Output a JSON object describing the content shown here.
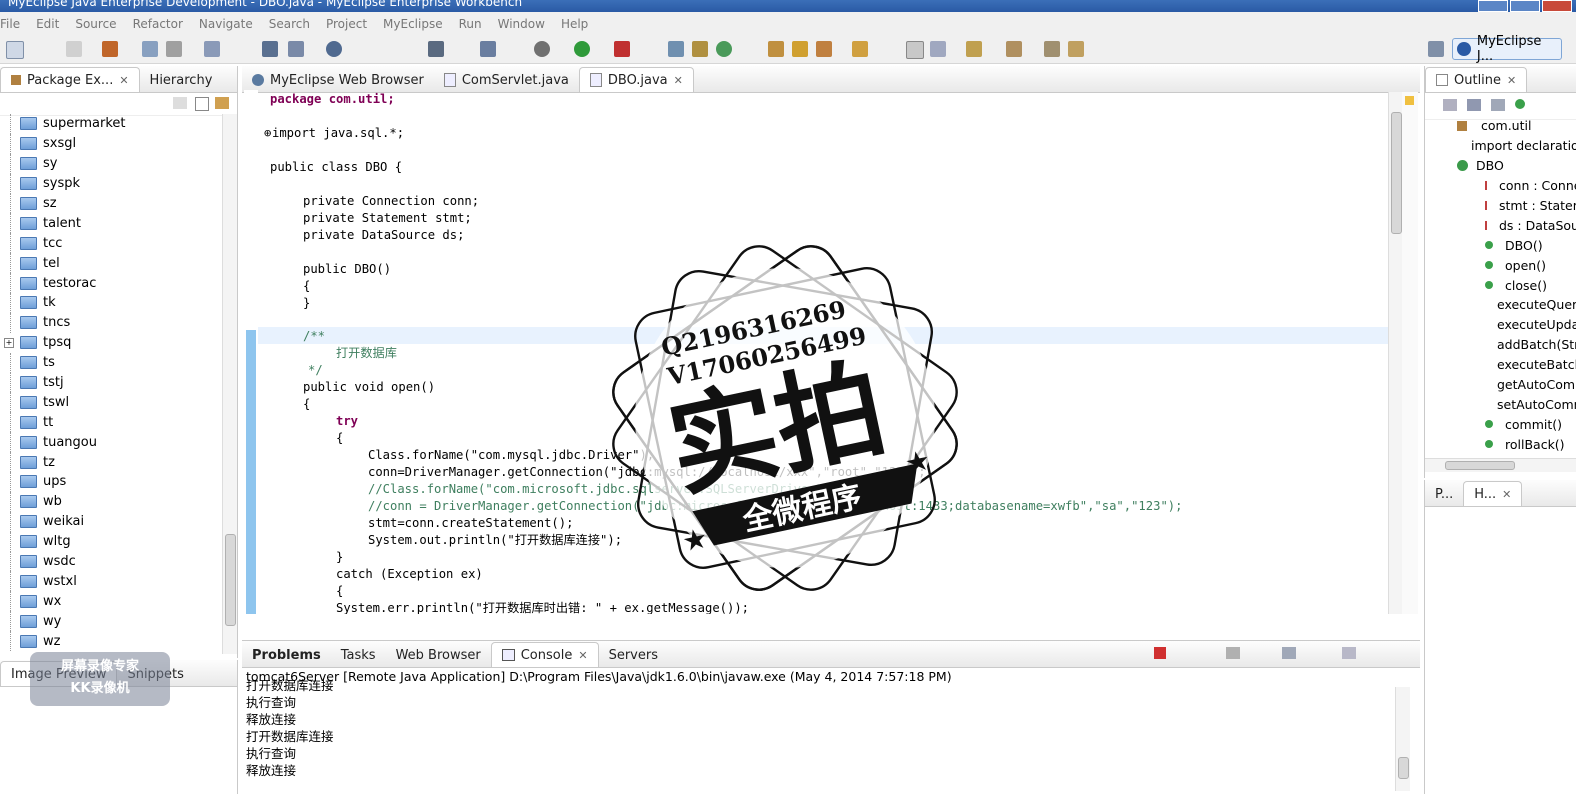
{
  "window": {
    "title": "MyEclipse Java Enterprise Development - DBO.java - MyEclipse Enterprise Workbench"
  },
  "menu": [
    "File",
    "Edit",
    "Source",
    "Refactor",
    "Navigate",
    "Search",
    "Project",
    "MyEclipse",
    "Run",
    "Window",
    "Help"
  ],
  "perspective": {
    "label": "MyEclipse J..."
  },
  "package_explorer": {
    "tabs": [
      "Package Ex...",
      "Hierarchy"
    ],
    "items": [
      "supermarket",
      "sxsgl",
      "sy",
      "syspk",
      "sz",
      "talent",
      "tcc",
      "tel",
      "testorac",
      "tk",
      "tncs",
      "tpsq",
      "ts",
      "tstj",
      "tswl",
      "tt",
      "tuangou",
      "tz",
      "ups",
      "wb",
      "weikai",
      "wltg",
      "wsdc",
      "wstxl",
      "wx",
      "wy",
      "wz"
    ]
  },
  "image_preview": {
    "tabs": [
      "Image Preview",
      "Snippets"
    ]
  },
  "editor": {
    "tabs": [
      "MyEclipse Web Browser",
      "ComServlet.java",
      "DBO.java"
    ],
    "lines": {
      "l1": "package com.util;",
      "l2": "import java.sql.*;",
      "l3": "public class DBO {",
      "l4": "private Connection conn;",
      "l5": "private Statement stmt;",
      "l6": "private DataSource ds;",
      "l7": "public DBO()",
      "l8": "{",
      "l9": "}",
      "l10": "/**",
      "l11": "打开数据库",
      "l12": "*/",
      "l13": "public void open()",
      "l14": "{",
      "l15": "try",
      "l16": "{",
      "l17": "Class.forName(\"com.mysql.jdbc.Driver\");",
      "l18": "conn=DriverManager.getConnection(\"jdbc:mysql://localhost/xxx\",\"root\",\"123\");",
      "l19": "//Class.forName(\"com.microsoft.jdbc.sqlserver.SQLServerDriver\");",
      "l20": "//conn = DriverManager.getConnection(\"jdbc:microsoft:sqlserver://localhost:1433;databasename=xwfb\",\"sa\",\"123\");",
      "l21": "stmt=conn.createStatement();",
      "l22": "System.out.println(\"打开数据库连接\");",
      "l23": "}",
      "l24": "catch (Exception ex)",
      "l25": "{",
      "l26": "System.err.println(\"打开数据库时出错: \" + ex.getMessage());"
    }
  },
  "outline": {
    "tab": "Outline",
    "items": [
      "com.util",
      "import declarations",
      "DBO",
      "conn : Connection",
      "stmt : Statement",
      "ds : DataSource",
      "DBO()",
      "open()",
      "close()",
      "executeQuery",
      "executeUpdate",
      "addBatch(String)",
      "executeBatch",
      "getAutoCommit",
      "setAutoCommit",
      "commit()",
      "rollBack()"
    ],
    "bottom_tabs": [
      "P...",
      "H..."
    ]
  },
  "console": {
    "tabs": [
      "Problems",
      "Tasks",
      "Web Browser",
      "Console",
      "Servers"
    ],
    "header": "tomcat6Server [Remote Java Application] D:\\Program Files\\Java\\jdk1.6.0\\bin\\javaw.exe (May 4, 2014 7:57:18 PM)",
    "lines": [
      "打开数据库连接",
      "执行查询",
      "释放连接",
      "打开数据库连接",
      "执行查询",
      "释放连接"
    ]
  },
  "watermark": {
    "line1": "Q2196316269",
    "line2": "V17060256499",
    "big": "实拍",
    "banner": "全微程序"
  },
  "recorder_logo": {
    "text1": "屏幕录像专家",
    "text2": "KK录像机"
  },
  "colors": {
    "keyword": "#7f0055",
    "string": "#2a00ff",
    "comment": "#3f7f5f",
    "field": "#0000c0",
    "titlebar": "#2a5aa5"
  }
}
